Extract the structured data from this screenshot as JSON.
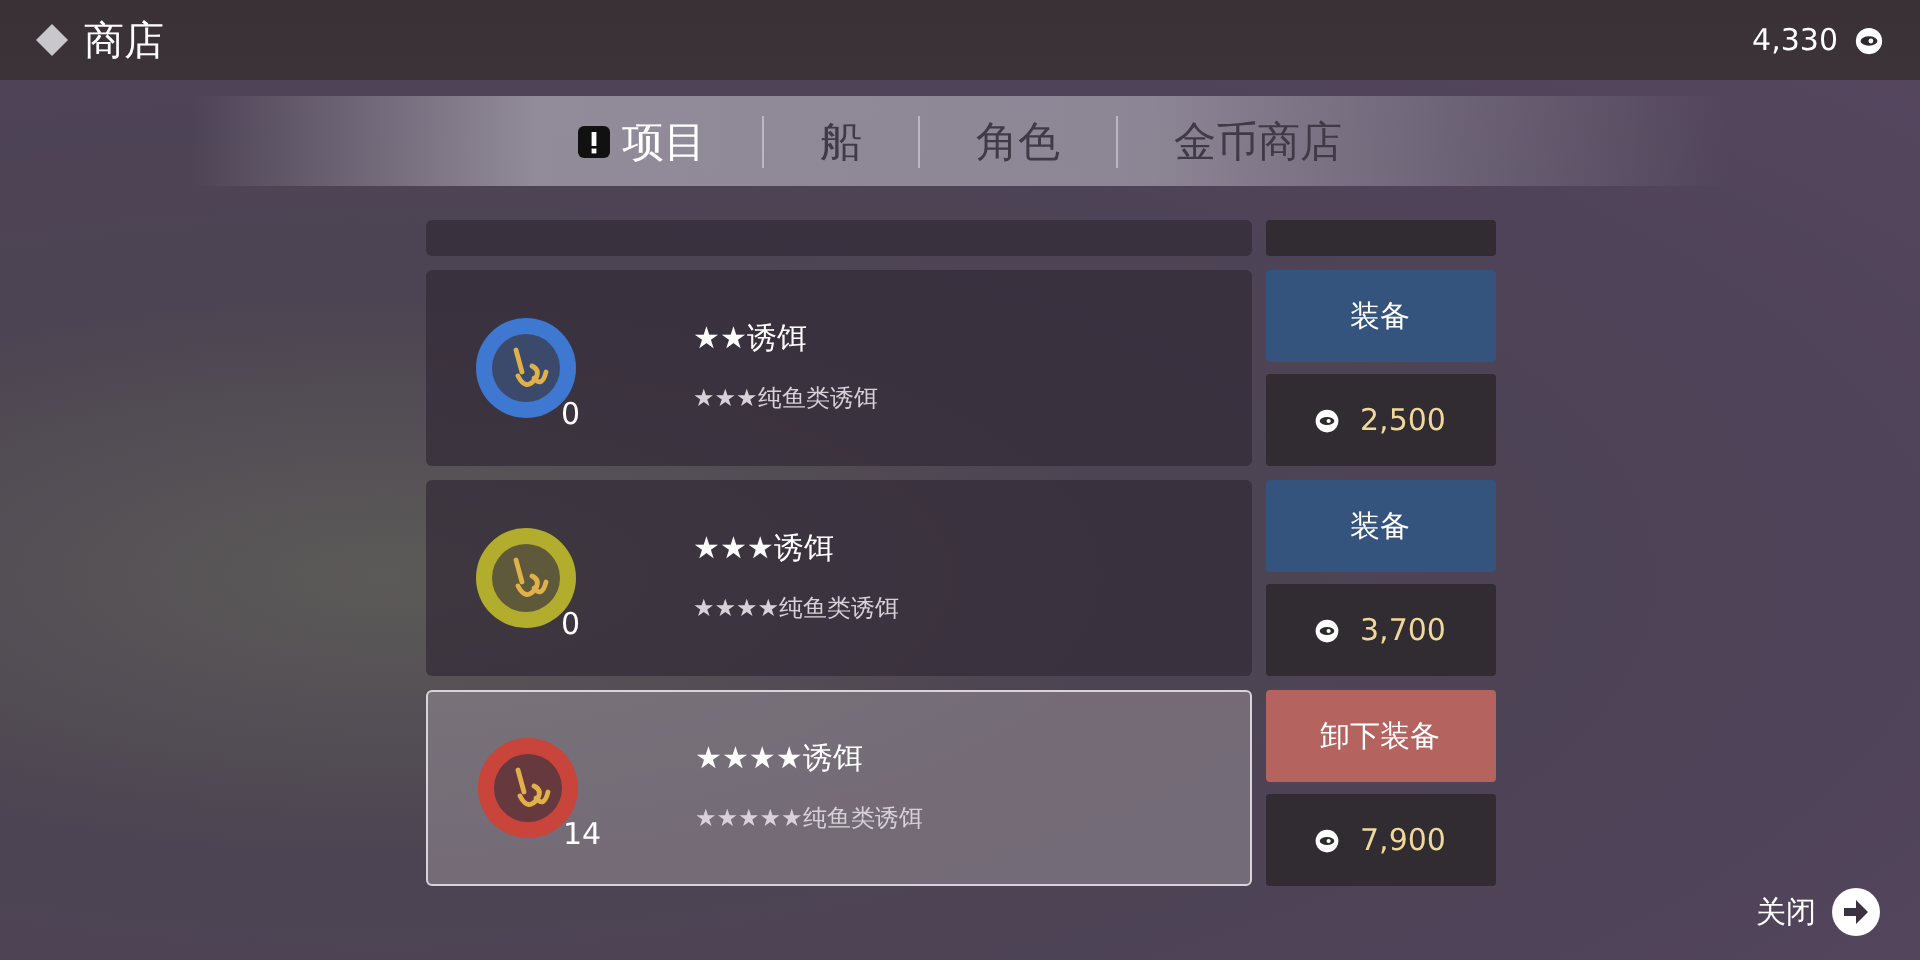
{
  "header": {
    "title": "商店",
    "coins": "4,330"
  },
  "tabs": [
    {
      "label": "项目",
      "selected": true,
      "alert": true
    },
    {
      "label": "船",
      "selected": false,
      "alert": false
    },
    {
      "label": "角色",
      "selected": false,
      "alert": false
    },
    {
      "label": "金币商店",
      "selected": false,
      "alert": false
    }
  ],
  "items": [
    {
      "name": "★★诱饵",
      "description": "★★★纯鱼类诱饵",
      "count": "0",
      "color": "#3f78d0",
      "selected": false,
      "action": {
        "kind": "equip",
        "label": "装备"
      },
      "price": "2,500"
    },
    {
      "name": "★★★诱饵",
      "description": "★★★★纯鱼类诱饵",
      "count": "0",
      "color": "#b3ad2e",
      "selected": false,
      "action": {
        "kind": "equip",
        "label": "装备"
      },
      "price": "3,700"
    },
    {
      "name": "★★★★诱饵",
      "description": "★★★★★纯鱼类诱饵",
      "count": "14",
      "color": "#c9443a",
      "selected": true,
      "action": {
        "kind": "unequip",
        "label": "卸下装备"
      },
      "price": "7,900"
    }
  ],
  "close": {
    "label": "关闭"
  }
}
